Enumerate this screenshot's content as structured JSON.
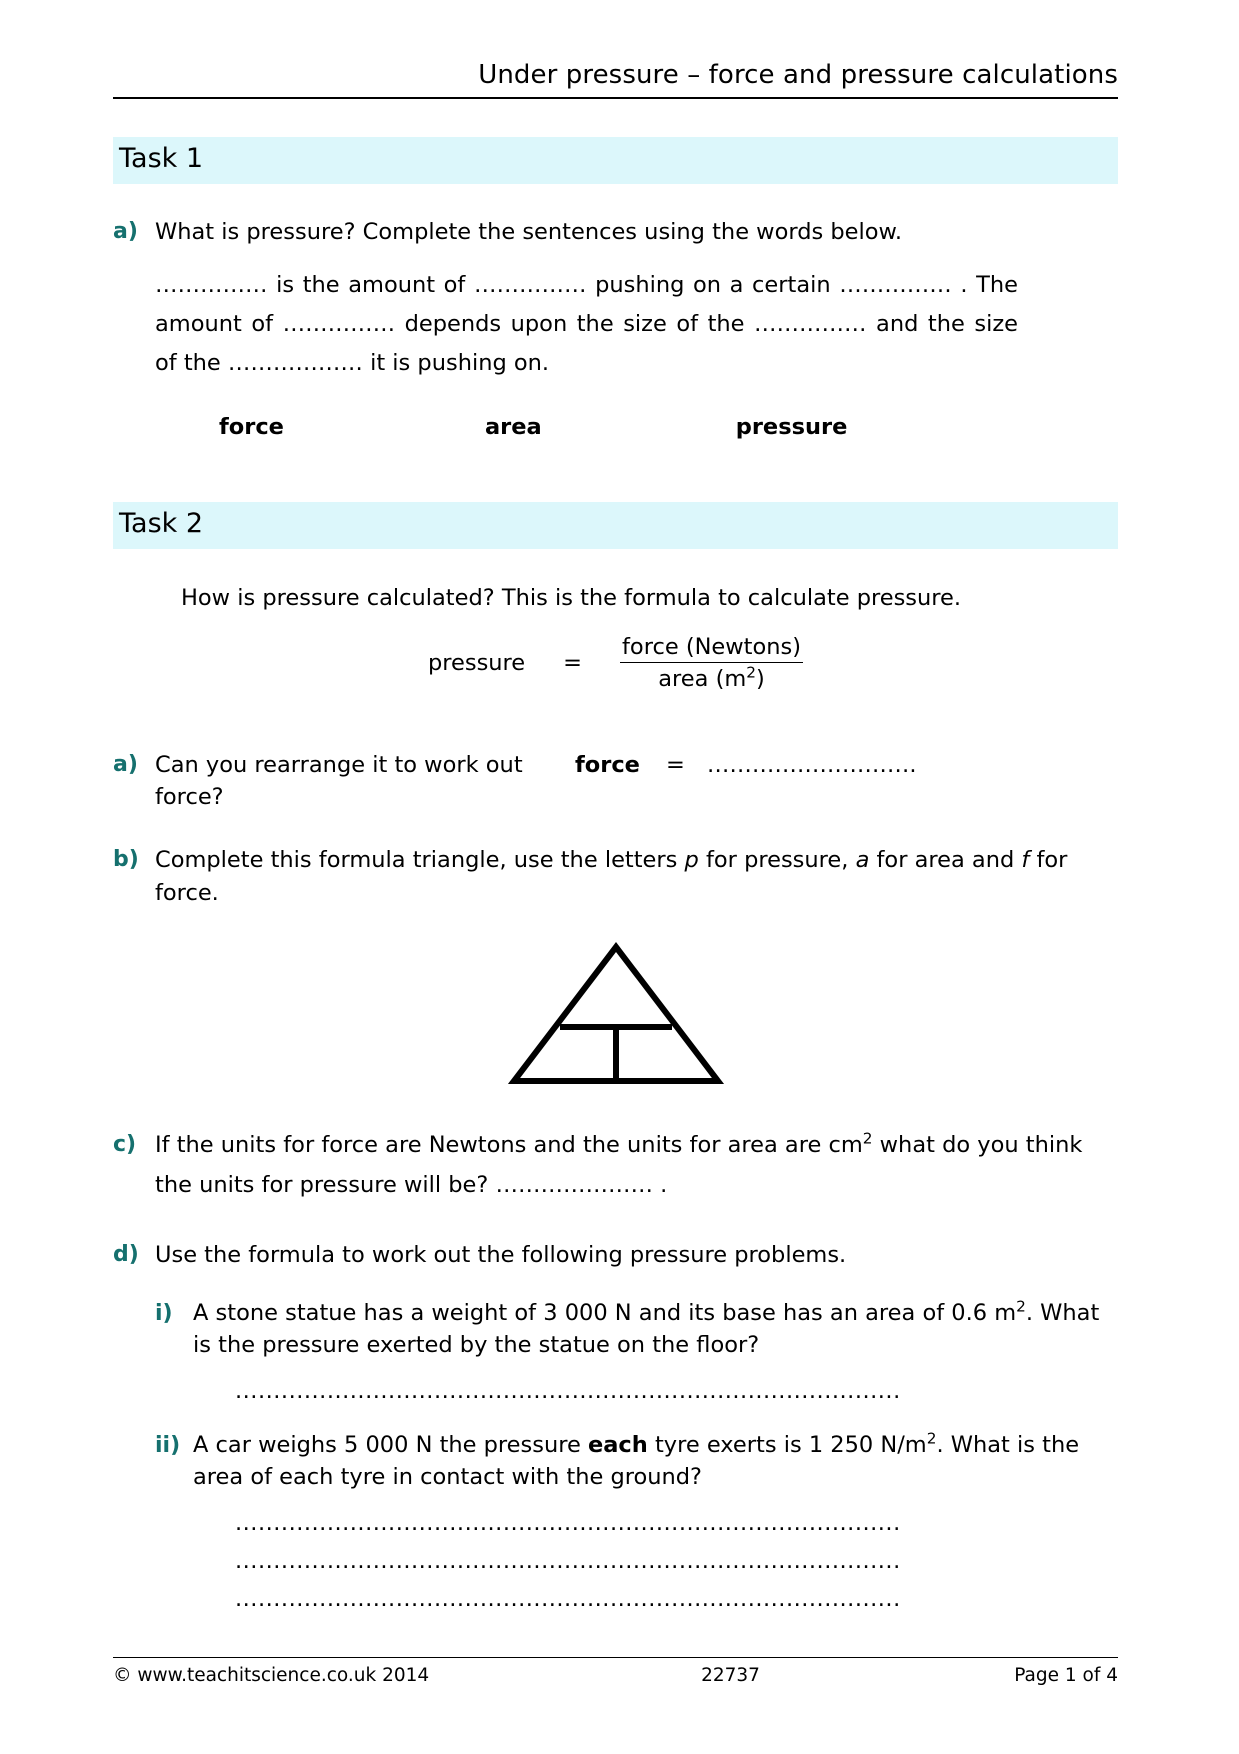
{
  "header": {
    "title": "Under pressure – force and pressure calculations"
  },
  "task1": {
    "bar_label": "Task 1",
    "a": {
      "label": "a)",
      "text": "What is pressure?  Complete the sentences using the words below."
    },
    "cloze": "…………… is the amount of …………… pushing on a certain …………… .  The amount of …………… depends upon the size of the …………… and the size of the ……………… it is pushing on.",
    "cloze_parts": {
      "p1": "……………",
      "p2": " is the amount of ",
      "p3": "……………",
      "p4": " pushing on a certain ",
      "p5": "……………",
      "p6": " .  The amount of ",
      "p7": "……………",
      "p8": " depends upon the size of the ",
      "p9": "……………",
      "p10": " and the size of the ",
      "p11": "………………",
      "p12": " it is pushing on."
    },
    "word_bank": [
      "force",
      "area",
      "pressure"
    ]
  },
  "task2": {
    "bar_label": "Task 2",
    "intro": "How is pressure calculated?  This is the formula to calculate pressure.",
    "formula": {
      "lhs": "pressure",
      "equals": "=",
      "numerator": "force (Newtons)",
      "denominator_text": "area (m",
      "denominator_sup": "2",
      "denominator_tail": ")"
    },
    "a": {
      "label": "a)",
      "question": "Can you rearrange it to work out force?",
      "force_label": "force",
      "equals": "=",
      "blank": "………………………."
    },
    "b": {
      "label": "b)",
      "text_1": "Complete this formula triangle, use the letters ",
      "var_p": "p",
      "text_2": " for pressure, ",
      "var_a": "a",
      "text_3": " for area and ",
      "var_f": "f",
      "text_4": " for force."
    },
    "c": {
      "label": "c)",
      "text_1": "If the units for force are Newtons and the units for area are cm",
      "sup": "2",
      "text_2": " what do you think the units for pressure will be?  ",
      "blank": "………………… ."
    },
    "d": {
      "label": "d)",
      "text": "Use the formula to work out the following pressure problems.",
      "items": [
        {
          "label": "i)",
          "text_1": "A stone statue has a weight of 3 000 N and its base has an area of 0.6 m",
          "sup": "2",
          "text_2": ".  What is the pressure exerted by the statue on the floor?",
          "answer_lines": [
            "......................................................................................."
          ]
        },
        {
          "label": "ii)",
          "text_1": "A car weighs 5 000 N the pressure ",
          "bold": "each",
          "text_2": " tyre exerts is 1 250 N/m",
          "sup": "2",
          "text_3": ". What is the area of each tyre in contact with the ground?",
          "answer_lines": [
            ".......................................................................................",
            ".......................................................................................",
            "......................................................................................."
          ]
        }
      ]
    }
  },
  "footer": {
    "copyright": "© www.teachitscience.co.uk 2014",
    "doc_id": "22737",
    "page": "Page 1 of 4"
  },
  "colors": {
    "task_bar": "#dcf7fb",
    "label_teal": "#15706e"
  }
}
